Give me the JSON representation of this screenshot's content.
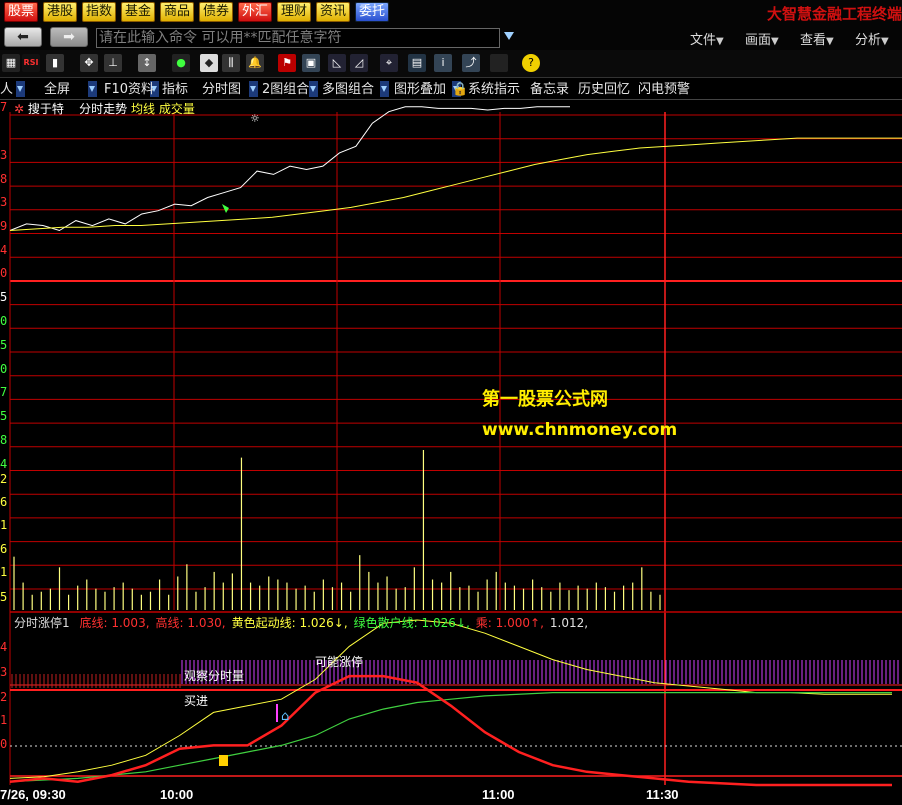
{
  "market_tabs": [
    {
      "label": "股票",
      "style": "red"
    },
    {
      "label": "港股",
      "style": "yellow"
    },
    {
      "label": "指数",
      "style": "yellow"
    },
    {
      "label": "基金",
      "style": "yellow"
    },
    {
      "label": "商品",
      "style": "yellow"
    },
    {
      "label": "债券",
      "style": "yellow"
    },
    {
      "label": "外汇",
      "style": "red"
    },
    {
      "label": "理财",
      "style": "yellow"
    },
    {
      "label": "资讯",
      "style": "yellow"
    },
    {
      "label": "委托",
      "style": "blue"
    }
  ],
  "brand_title": "大智慧金融工程终端",
  "command_input": {
    "placeholder": "请在此输入命令    可以用**匹配任意字符"
  },
  "top_menus": [
    "文件",
    "画面",
    "查看",
    "分析"
  ],
  "toolbar_icons": [
    "crosshair-icon",
    "rsi-icon",
    "candle-icon",
    "move-icon",
    "pointer-icon",
    "zoom-icon",
    "traffic-light-icon",
    "diamond-icon",
    "bars-icon",
    "bell-icon",
    "flag-icon",
    "window-icon",
    "measure-icon",
    "measure2-icon",
    "compass-icon",
    "calendar-icon",
    "info-icon",
    "trend-icon",
    "settings-icon",
    "help-icon"
  ],
  "func_tabs": [
    "人",
    "全屏",
    "F10资料",
    "指标",
    "分时图",
    "2图组合",
    "多图组合",
    "图形叠加",
    "系统指示",
    "备忘录",
    "历史回忆",
    "闪电预警"
  ],
  "price_panel": {
    "legend": {
      "tag": "搜于特",
      "title": "分时走势",
      "avg_label": "均线",
      "vol_label": "成交量"
    },
    "y_labels": [
      "7",
      "3",
      "8",
      "3",
      "9",
      "4",
      "0",
      "5",
      "0",
      "5",
      "0",
      "7",
      "5",
      "8",
      "4"
    ],
    "vol_y_labels": [
      "2",
      "6",
      "1",
      "6",
      "1",
      "5"
    ]
  },
  "indicator_panel": {
    "name": "分时涨停1",
    "items": [
      {
        "label": "底线:",
        "value": "1.003,",
        "color": "#ff3030"
      },
      {
        "label": "高线:",
        "value": "1.030,",
        "color": "#ff3030"
      },
      {
        "label": "黄色起动线:",
        "value": "1.026↓,",
        "color": "#ffff40"
      },
      {
        "label": "绿色散户线:",
        "value": "1.026↓,",
        "color": "#40ff40"
      },
      {
        "label": "乘:",
        "value": "1.000↑,",
        "color": "#ff3030"
      },
      {
        "label": "",
        "value": "1.012,",
        "color": "#e0e0e0"
      }
    ],
    "y_labels": [
      "4",
      "3",
      "2",
      "1",
      "0"
    ],
    "annotations": {
      "observe": "观察分时量",
      "limit_up": "可能涨停",
      "buy": "买进"
    }
  },
  "time_axis": [
    "7/26, 09:30",
    "10:00",
    "11:00",
    "11:30"
  ],
  "watermark": {
    "line1": "第一股票公式网",
    "line2": "www.chnmoney.com"
  },
  "colors": {
    "price": "#ffffff",
    "avg": "#ffff40",
    "volume": "#ffff80",
    "grid": "#c00000",
    "sep": "#ff2020",
    "start_line": "#ffff40",
    "retail_line": "#40d040",
    "multiplier": "#ff2020"
  },
  "chart_data": [
    {
      "type": "line",
      "title": "分时走势",
      "series": [
        {
          "name": "分时走势",
          "values": [
            0.3,
            0.34,
            0.33,
            0.3,
            0.36,
            0.33,
            0.37,
            0.34,
            0.4,
            0.42,
            0.46,
            0.45,
            0.5,
            0.53,
            0.56,
            0.66,
            0.64,
            0.69,
            0.67,
            0.69,
            0.77,
            0.81,
            0.95,
            1.02,
            1.05,
            1.05,
            1.04,
            1.04,
            1.04,
            1.03,
            1.04,
            1.04,
            1.05,
            1.05,
            1.05
          ]
        },
        {
          "name": "均线",
          "values": [
            0.3,
            0.31,
            0.32,
            0.32,
            0.33,
            0.33,
            0.34,
            0.35,
            0.36,
            0.37,
            0.38,
            0.4,
            0.42,
            0.44,
            0.47,
            0.5,
            0.54,
            0.58,
            0.62,
            0.66,
            0.7,
            0.73,
            0.76,
            0.78,
            0.8,
            0.81,
            0.82,
            0.83,
            0.84,
            0.85,
            0.86,
            0.86,
            0.86,
            0.86,
            0.86
          ]
        }
      ]
    },
    {
      "type": "bar",
      "title": "成交量",
      "values": [
        0.35,
        0.18,
        0.1,
        0.12,
        0.14,
        0.28,
        0.1,
        0.16,
        0.2,
        0.14,
        0.12,
        0.15,
        0.18,
        0.14,
        0.1,
        0.12,
        0.2,
        0.1,
        0.22,
        0.3,
        0.12,
        0.15,
        0.25,
        0.18,
        0.24,
        1.0,
        0.18,
        0.16,
        0.22,
        0.2,
        0.18,
        0.14,
        0.16,
        0.12,
        0.2,
        0.15,
        0.18,
        0.12,
        0.36,
        0.25,
        0.18,
        0.22,
        0.14,
        0.15,
        0.28,
        1.05,
        0.2,
        0.18,
        0.25,
        0.15,
        0.16,
        0.12,
        0.2,
        0.25,
        0.18,
        0.16,
        0.14,
        0.2,
        0.15,
        0.12,
        0.18,
        0.13,
        0.16,
        0.14,
        0.18,
        0.15,
        0.12,
        0.16,
        0.18,
        0.28,
        0.12,
        0.1
      ]
    },
    {
      "type": "line",
      "title": "分时涨停1",
      "series": [
        {
          "name": "黄色起动线",
          "values": [
            0.2,
            0.25,
            0.4,
            0.6,
            0.9,
            1.5,
            2.2,
            2.4,
            2.6,
            3.2,
            4.2,
            4.9,
            5.0,
            4.9,
            4.6,
            4.2,
            3.8,
            3.5,
            3.3,
            3.1,
            3.0,
            2.9,
            2.8,
            2.8,
            2.75,
            2.75,
            2.75
          ]
        },
        {
          "name": "绿色散户线",
          "values": [
            0.1,
            0.15,
            0.2,
            0.3,
            0.4,
            0.6,
            0.8,
            1.0,
            1.2,
            1.5,
            2.0,
            2.3,
            2.5,
            2.6,
            2.7,
            2.75,
            2.8,
            2.8,
            2.8,
            2.8,
            2.8,
            2.8,
            2.8,
            2.8,
            2.8,
            2.8,
            2.8
          ]
        },
        {
          "name": "乘",
          "values": [
            0.1,
            0.2,
            0.1,
            0.3,
            0.6,
            1.1,
            1.2,
            1.2,
            1.8,
            2.8,
            3.3,
            3.3,
            3.1,
            2.4,
            1.6,
            1.0,
            0.6,
            0.4,
            0.3,
            0.2,
            0.1,
            0.05,
            0,
            0,
            0,
            0,
            0
          ]
        }
      ],
      "ylim": [
        0,
        5
      ]
    }
  ]
}
